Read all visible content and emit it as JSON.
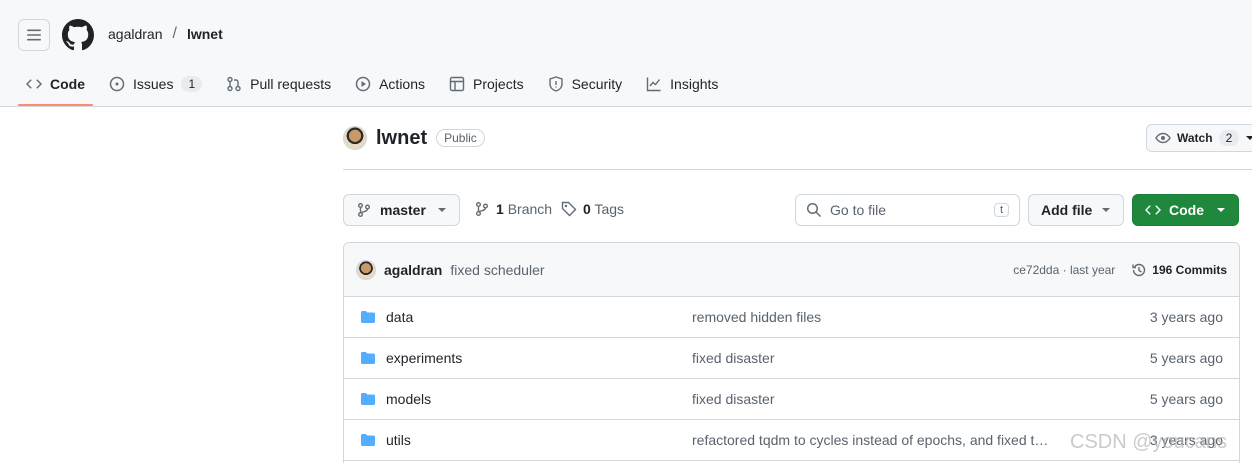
{
  "header": {
    "owner": "agaldran",
    "separator": "/",
    "repo": "lwnet"
  },
  "tabs": [
    {
      "label": "Code",
      "icon": "code-icon",
      "active": true
    },
    {
      "label": "Issues",
      "icon": "issue-icon",
      "count": "1"
    },
    {
      "label": "Pull requests",
      "icon": "pull-request-icon"
    },
    {
      "label": "Actions",
      "icon": "play-icon"
    },
    {
      "label": "Projects",
      "icon": "table-icon"
    },
    {
      "label": "Security",
      "icon": "shield-icon"
    },
    {
      "label": "Insights",
      "icon": "graph-icon"
    }
  ],
  "repo": {
    "name": "lwnet",
    "visibility": "Public",
    "watch_label": "Watch",
    "watch_count": "2"
  },
  "toolbar": {
    "branch": "master",
    "branches_count": "1",
    "branches_label": "Branch",
    "tags_count": "0",
    "tags_label": "Tags",
    "search_placeholder": "Go to file",
    "search_shortcut": "t",
    "add_file_label": "Add file",
    "code_label": "Code"
  },
  "commit": {
    "author": "agaldran",
    "message": "fixed scheduler",
    "meta": "ce72dda · last year",
    "commits_label": "196 Commits"
  },
  "files": [
    {
      "name": "data",
      "message": "removed hidden files",
      "date": "3 years ago"
    },
    {
      "name": "experiments",
      "message": "fixed disaster",
      "date": "5 years ago"
    },
    {
      "name": "models",
      "message": "fixed disaster",
      "date": "5 years ago"
    },
    {
      "name": "utils",
      "message": "refactored tqdm to cycles instead of epochs, and fixed transf...",
      "date": "3 years ago"
    }
  ],
  "watermark": "CSDN @youcans",
  "colors": {
    "accent_tab": "#fd8c73",
    "code_button": "#1f883d",
    "folder": "#54aeff"
  }
}
